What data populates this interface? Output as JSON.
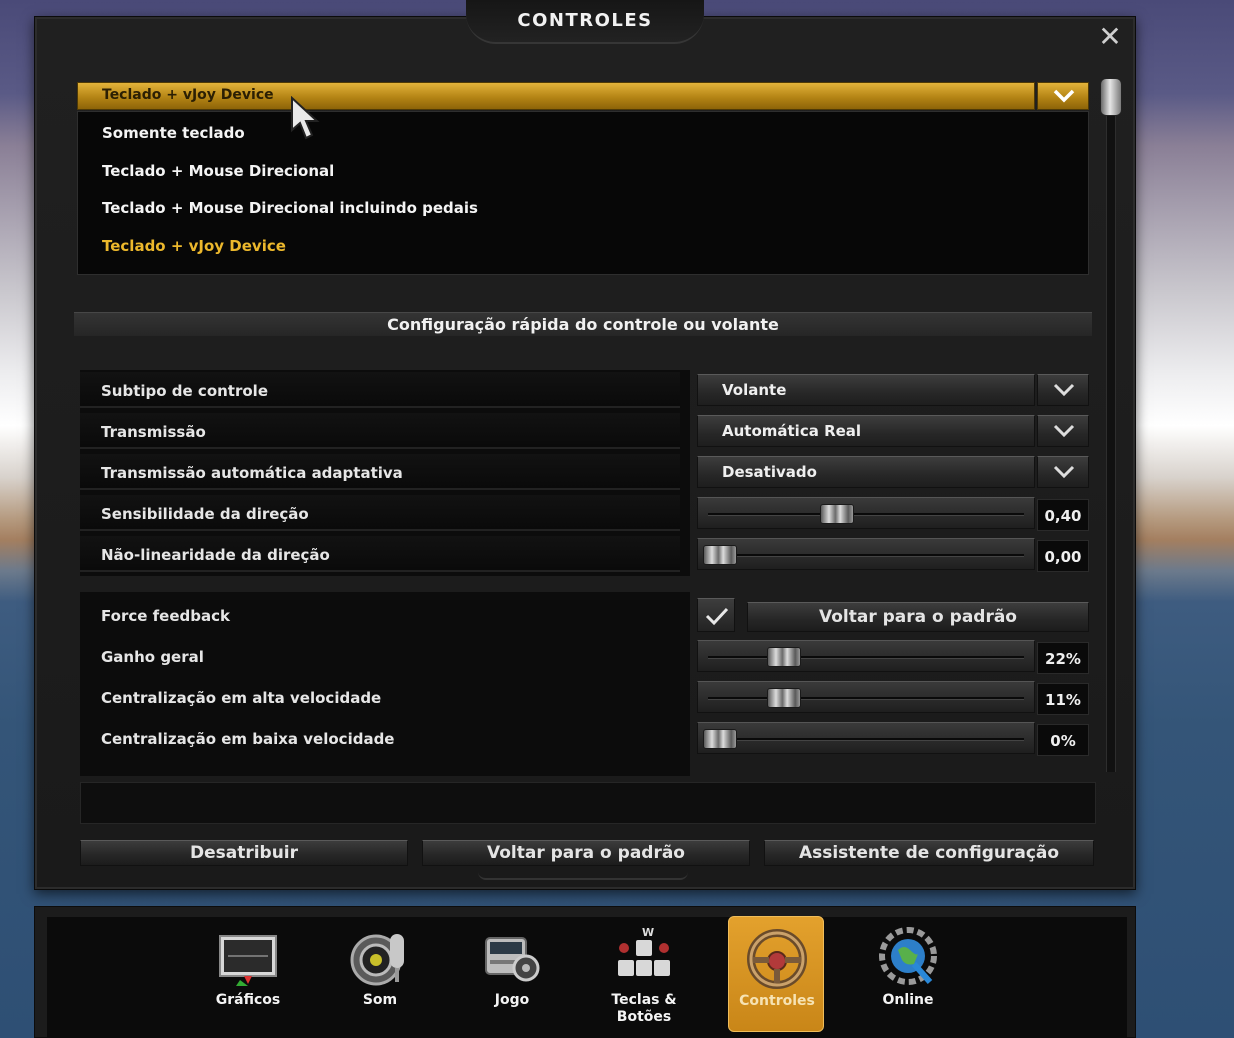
{
  "dialog": {
    "title": "CONTROLES",
    "close_icon": "close-icon"
  },
  "device_select": {
    "value": "Teclado + vJoy Device",
    "options": [
      "Somente teclado",
      "Teclado + Mouse Direcional",
      "Teclado + Mouse Direcional incluindo pedais",
      "Teclado + vJoy Device"
    ],
    "selected_index": 3
  },
  "section_title": "Configuração rápida do controle ou volante",
  "settings": [
    {
      "label": "Subtipo de controle",
      "type": "dropdown",
      "value": "Volante"
    },
    {
      "label": "Transmissão",
      "type": "dropdown",
      "value": "Automática Real"
    },
    {
      "label": "Transmissão automática adaptativa",
      "type": "dropdown",
      "value": "Desativado"
    },
    {
      "label": "Sensibilidade da direção",
      "type": "slider",
      "value": "0,40",
      "level": 0.4
    },
    {
      "label": "Não-linearidade da direção",
      "type": "slider",
      "value": "0,00",
      "level": 0.0
    }
  ],
  "force_feedback": {
    "label": "Force feedback",
    "checked": true,
    "reset_label": "Voltar para o padrão",
    "items": [
      {
        "label": "Ganho geral",
        "value": "22%",
        "level": 0.22
      },
      {
        "label": "Centralização em alta velocidade",
        "value": "11%",
        "level": 0.22
      },
      {
        "label": "Centralização em baixa velocidade",
        "value": "0%",
        "level": 0.0
      }
    ]
  },
  "buttons": {
    "unassign": "Desatribuir",
    "reset": "Voltar para o padrão",
    "wizard": "Assistente de configuração"
  },
  "nav": [
    {
      "label": "Gráficos",
      "icon": "graphics-monitor-icon",
      "active": false
    },
    {
      "label": "Som",
      "icon": "sound-speaker-icon",
      "active": false
    },
    {
      "label": "Jogo",
      "icon": "truck-icon",
      "active": false
    },
    {
      "label": "Teclas & Botões",
      "icon": "keyboard-keys-icon",
      "active": false
    },
    {
      "label": "Controles",
      "icon": "steering-wheel-icon",
      "active": true
    },
    {
      "label": "Online",
      "icon": "online-globe-icon",
      "active": false
    }
  ],
  "colors": {
    "accent_gold": "#d9a42c",
    "selected_text": "#ecb82c",
    "nav_active": "#e3a12d"
  }
}
